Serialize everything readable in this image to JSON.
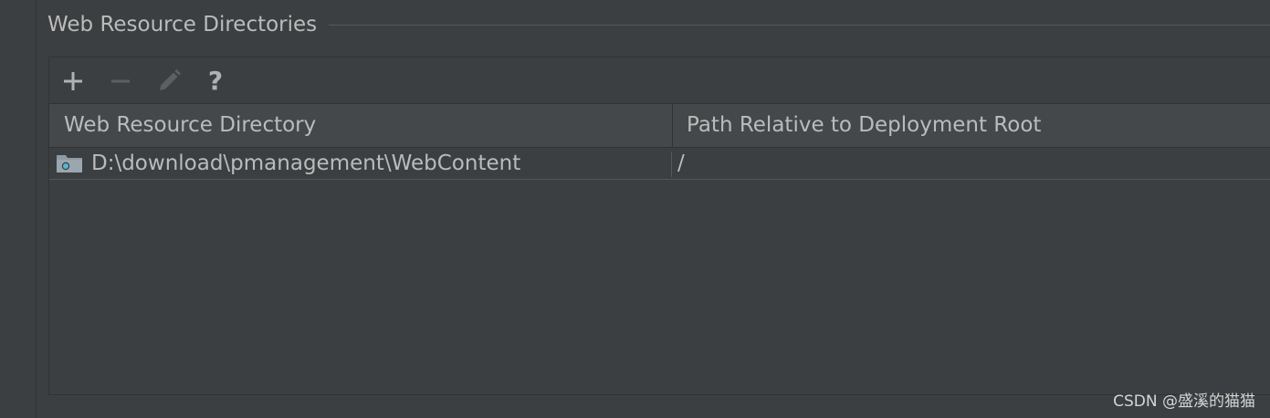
{
  "section": {
    "title": "Web Resource Directories"
  },
  "toolbar": {
    "add_icon": "plus-icon",
    "remove_icon": "minus-icon",
    "edit_icon": "pencil-icon",
    "help_label": "?"
  },
  "table": {
    "columns": [
      "Web Resource Directory",
      "Path Relative to Deployment Root"
    ],
    "rows": [
      {
        "icon": "web-folder-icon",
        "directory": "D:\\download\\pmanagement\\WebContent",
        "path": "/"
      }
    ]
  },
  "watermark": "CSDN @盛溪的猫猫",
  "colors": {
    "background": "#3c3f41",
    "header_background": "#45484a",
    "text": "#bbbbbb",
    "icon_enabled": "#afb1b3",
    "icon_disabled": "#5e6060",
    "folder_accent": "#5ab4d6"
  }
}
